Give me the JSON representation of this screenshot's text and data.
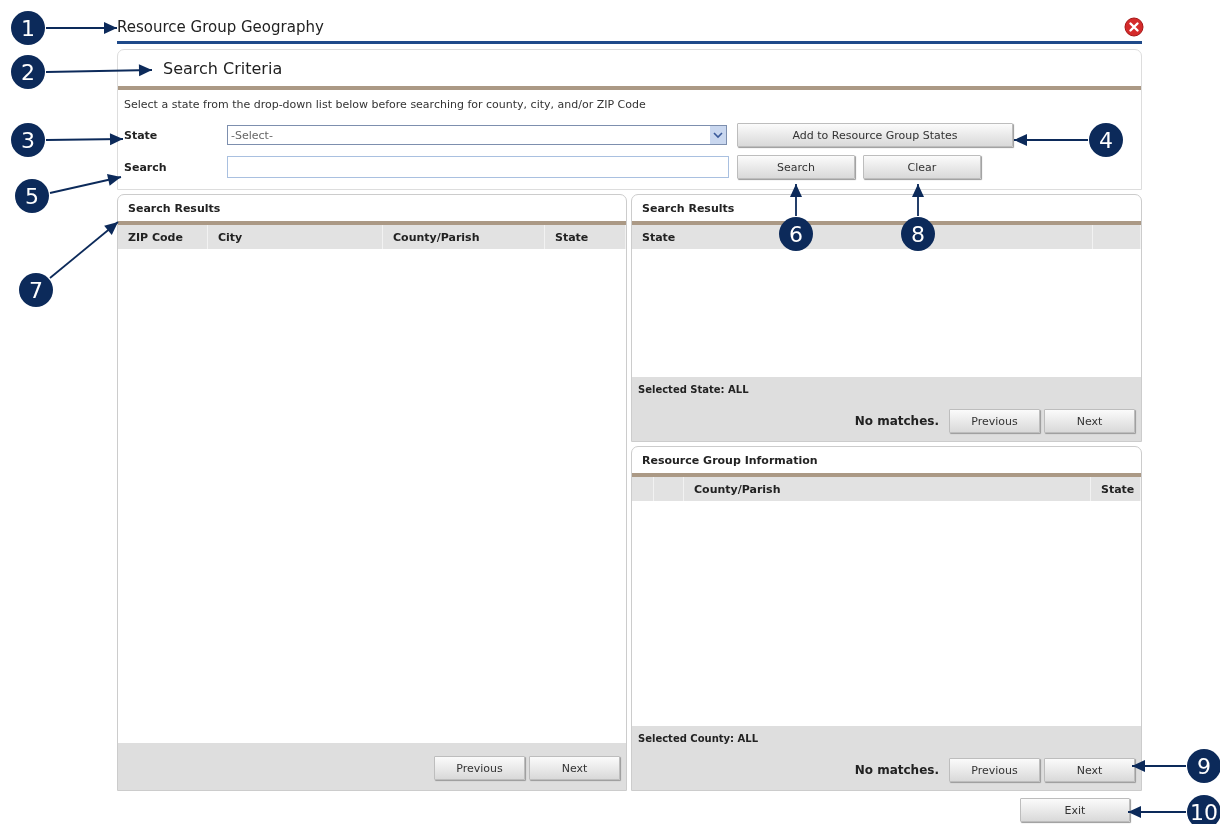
{
  "window": {
    "title": "Resource Group Geography"
  },
  "search_criteria": {
    "title": "Search Criteria",
    "instructions": "Select a state from the drop-down list below before searching for county, city, and/or ZIP Code",
    "state_label": "State",
    "state_select": {
      "value": "-Select-"
    },
    "add_button": "Add to Resource Group States",
    "search_label": "Search",
    "search_button": "Search",
    "clear_button": "Clear"
  },
  "results_panel": {
    "title": "Search Results",
    "columns": [
      "ZIP Code",
      "City",
      "County/Parish",
      "State"
    ],
    "buttons": [
      "Previous",
      "Next"
    ]
  },
  "states_panel": {
    "title": "Search Results",
    "columns": [
      "State"
    ],
    "selected_text": "Selected State: ALL",
    "status": "No matches.",
    "buttons": [
      "Previous",
      "Next"
    ]
  },
  "group_panel": {
    "title": "Resource Group Information",
    "columns": [
      "County/Parish",
      "State"
    ],
    "selected_text": "Selected County: ALL",
    "status": "No matches.",
    "buttons": [
      "Previous",
      "Next"
    ]
  },
  "exit_button": "Exit",
  "callouts": [
    {
      "number": "1"
    },
    {
      "number": "2"
    },
    {
      "number": "3"
    },
    {
      "number": "4"
    },
    {
      "number": "5"
    },
    {
      "number": "6"
    },
    {
      "number": "7"
    },
    {
      "number": "8"
    },
    {
      "number": "9"
    },
    {
      "number": "10"
    }
  ]
}
